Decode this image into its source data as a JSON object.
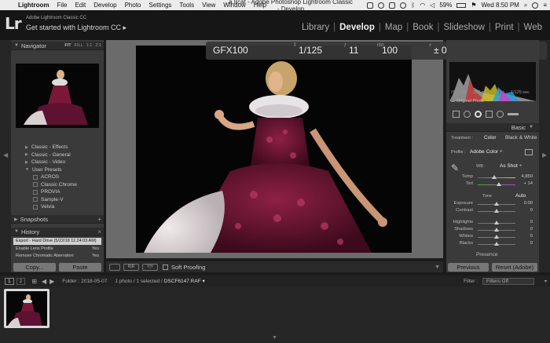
{
  "menubar": {
    "items": [
      "Lightroom",
      "File",
      "Edit",
      "Develop",
      "Photo",
      "Settings",
      "Tools",
      "View",
      "Window",
      "Help"
    ],
    "window_title": "a.lrcat - Adobe Photoshop Lightroom Classic - Develop",
    "battery": "59%",
    "clock": "Wed 8:50 PM"
  },
  "identity": {
    "logo": "Lr",
    "small": "Adobe Lightroom Classic CC",
    "big": "Get started with Lightroom CC ▸"
  },
  "modules": [
    "Library",
    "Develop",
    "Map",
    "Book",
    "Slideshow",
    "Print",
    "Web"
  ],
  "navigator": {
    "title": "Navigator",
    "zoom_options": [
      "FIT",
      "FILL",
      "1:1",
      "2:1"
    ]
  },
  "presets": [
    {
      "label": "Classic - Effects",
      "level": 1
    },
    {
      "label": "Classic - General",
      "level": 1
    },
    {
      "label": "Classic - Video",
      "level": 1
    },
    {
      "label": "User Presets",
      "level": 1,
      "open": true
    },
    {
      "label": "ACROS",
      "level": 2
    },
    {
      "label": "Classic Chrome",
      "level": 2
    },
    {
      "label": "PROVIA",
      "level": 2
    },
    {
      "label": "Sample-V",
      "level": 2
    },
    {
      "label": "Velvia",
      "level": 2
    }
  ],
  "snapshots": {
    "title": "Snapshots",
    "add": "+"
  },
  "history": {
    "title": "History",
    "close": "×",
    "items": [
      {
        "label": "Export - Hard Drive (5/22/18 11:24:03 AM)",
        "value": ""
      },
      {
        "label": "Enable Lens Profile",
        "value": "Yes"
      },
      {
        "label": "Remove Chromatic Aberration",
        "value": "Yes"
      }
    ]
  },
  "left_buttons": {
    "copy": "Copy...",
    "paste": "Paste"
  },
  "overlay": {
    "camera": "GFX100",
    "shutter": "1/125",
    "aperture": "11",
    "iso": "100",
    "exposure": "± 0",
    "wb_badge": "WB"
  },
  "toolbar": {
    "soft_proofing": "Soft Proofing"
  },
  "histogram": {
    "iso": "ISO 160",
    "focal": "280 mm",
    "fstop": "f/11",
    "shutter": "1/125 sec",
    "original_photo": "Original Photo"
  },
  "basic": {
    "title": "Basic",
    "treatment_label": "Treatment :",
    "color": "Color",
    "bw": "Black & White",
    "profile_label": "Profile :",
    "profile": "Adobe Color ÷",
    "wb_label": "WB :",
    "wb_value": "As Shot ÷",
    "temp_label": "Temp",
    "temp_value": "4,850",
    "tint_label": "Tint",
    "tint_value": "+ 14",
    "tone_label": "Tone",
    "auto_label": "Auto",
    "exposure_label": "Exposure",
    "exposure_value": "0.00",
    "contrast_label": "Contrast",
    "contrast_value": "0",
    "highlights_label": "Highlights",
    "highlights_value": "0",
    "shadows_label": "Shadows",
    "shadows_value": "0",
    "whites_label": "Whites",
    "whites_value": "0",
    "blacks_label": "Blacks",
    "blacks_value": "0",
    "presence_label": "Presence"
  },
  "right_buttons": {
    "previous": "Previous",
    "reset": "Reset (Adobe)"
  },
  "filmbar": {
    "screen1": "1",
    "screen2": "2",
    "folder_info": "Folder : 2018-05-07",
    "selection": "1 photo / 1 selected /",
    "filename": "DSCF6147.RAF ▾",
    "filter_label": "Filter :",
    "filter_value": "Filters Off"
  },
  "colors": {
    "accent": "#f2f2f2",
    "panel": "#3a3a3a",
    "menubar": "#ececec"
  }
}
